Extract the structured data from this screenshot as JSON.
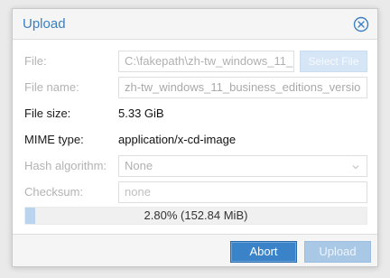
{
  "window": {
    "title": "Upload"
  },
  "icons": {
    "close": "close-circle-icon",
    "chevron": "chevron-down-icon"
  },
  "form": {
    "file": {
      "label": "File:",
      "value": "C:\\fakepath\\zh-tw_windows_11_",
      "button": "Select File"
    },
    "file_name": {
      "label": "File name:",
      "value": "zh-tw_windows_11_business_editions_versio"
    },
    "file_size": {
      "label": "File size:",
      "value": "5.33 GiB"
    },
    "mime_type": {
      "label": "MIME type:",
      "value": "application/x-cd-image"
    },
    "hash_algorithm": {
      "label": "Hash algorithm:",
      "value": "None"
    },
    "checksum": {
      "label": "Checksum:",
      "placeholder": "none"
    }
  },
  "progress": {
    "fraction": 0.028,
    "text": "2.80% (152.84 MiB)"
  },
  "footer": {
    "abort_label": "Abort",
    "upload_label": "Upload"
  },
  "colors": {
    "accent": "#3a83c9",
    "title": "#3a7fc1",
    "progress_fill": "#b9d4ec"
  }
}
